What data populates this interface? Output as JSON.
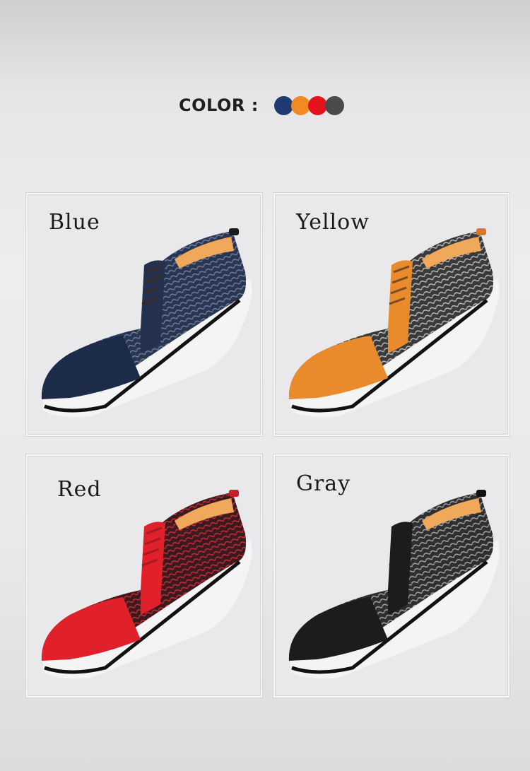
{
  "header": {
    "color_label": "COLOR :",
    "swatches": [
      {
        "name": "blue",
        "hex": "#1f3a70"
      },
      {
        "name": "orange",
        "hex": "#f08a22"
      },
      {
        "name": "red",
        "hex": "#e3121d"
      },
      {
        "name": "gray",
        "hex": "#4a4a4a"
      }
    ]
  },
  "variants": [
    {
      "label": "Blue",
      "toe_color": "#1d2b4a",
      "pattern_color": "#4a5e86"
    },
    {
      "label": "Yellow",
      "toe_color": "#e98a2c",
      "pattern_color": "#8c8c8c"
    },
    {
      "label": "Red",
      "toe_color": "#e0202a",
      "pattern_color": "#a9232c"
    },
    {
      "label": "Gray",
      "toe_color": "#1c1c1c",
      "pattern_color": "#8a8a8a"
    }
  ]
}
